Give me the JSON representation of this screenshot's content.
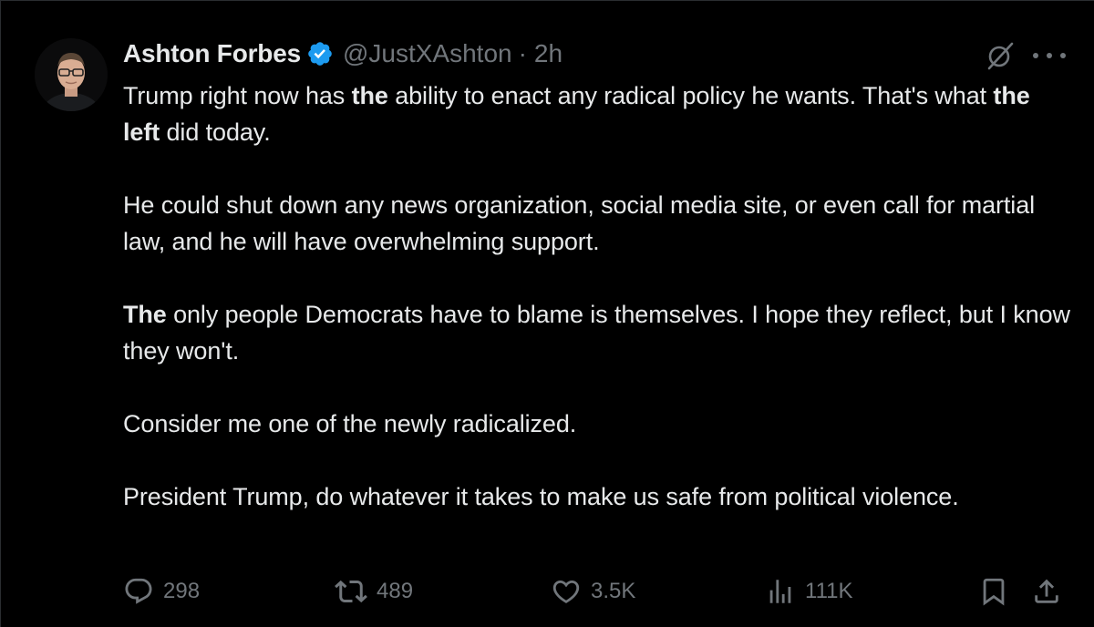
{
  "author": {
    "display_name": "Ashton Forbes",
    "handle": "@JustXAshton",
    "separator": "·",
    "time": "2h",
    "verified_color": "#1d9bf0"
  },
  "tweet": {
    "p1_a": "Trump right now has ",
    "p1_b": "the",
    "p1_c": " ability to enact any radical policy he wants. That's what ",
    "p1_d": "the left",
    "p1_e": " did today.",
    "p2": "He could shut down any news organization, social media site, or even call for martial law, and he will have overwhelming support.",
    "p3_a": "The",
    "p3_b": " only people Democrats have to blame is themselves. I hope they reflect, but I know they won't.",
    "p4": "Consider me one of the newly radicalized.",
    "p5": "President Trump, do whatever it takes to make us safe from political violence."
  },
  "actions": {
    "replies": "298",
    "reposts": "489",
    "likes": "3.5K",
    "views": "111K"
  },
  "icons": {
    "reply": "reply-icon",
    "repost": "repost-icon",
    "like": "heart-icon",
    "views": "views-icon",
    "bookmark": "bookmark-icon",
    "share": "share-icon",
    "grok": "grok-icon",
    "more": "more-icon",
    "verified": "verified-badge-icon"
  },
  "colors": {
    "background": "#000000",
    "text": "#e7e9ea",
    "secondary": "#71767b",
    "accent": "#1d9bf0"
  }
}
